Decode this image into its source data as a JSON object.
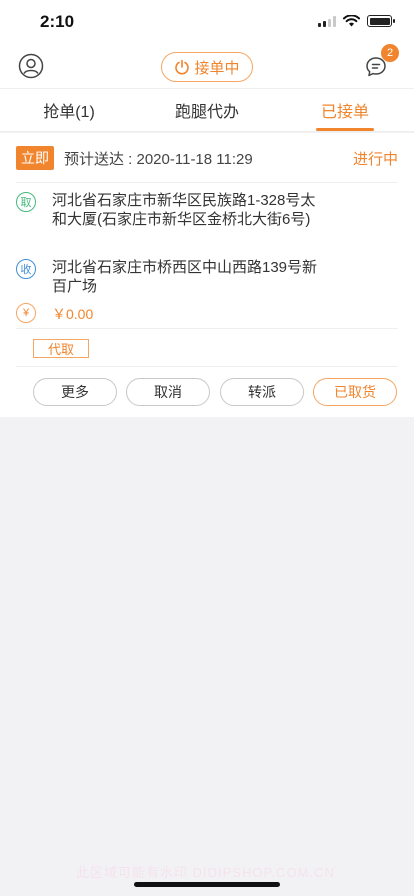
{
  "status_bar": {
    "time": "2:10"
  },
  "header": {
    "toggle_label": "接单中",
    "message_badge": "2"
  },
  "tabs": [
    {
      "label": "抢单(1)"
    },
    {
      "label": "跑腿代办"
    },
    {
      "label": "已接单",
      "active": true
    }
  ],
  "order": {
    "tag": "立即",
    "eta": "预计送达 : 2020-11-18 11:29",
    "state": "进行中",
    "pickup_icon": "取",
    "pickup_address": "河北省石家庄市新华区民族路1-328号太和大厦(石家庄市新华区金桥北大街6号)",
    "receive_icon": "收",
    "receive_address": "河北省石家庄市桥西区中山西路139号新百广场",
    "fee_icon": "¥",
    "fee": "￥0.00",
    "proxy_tag": "代取"
  },
  "actions": {
    "more": "更多",
    "cancel": "取消",
    "transfer": "转派",
    "picked": "已取货"
  },
  "watermark": "此区域可能有水印 DIDIPSHOP.COM.CN",
  "colors": {
    "accent": "#f0852e",
    "pickup": "#45b97c",
    "receive": "#3f8fd8"
  }
}
